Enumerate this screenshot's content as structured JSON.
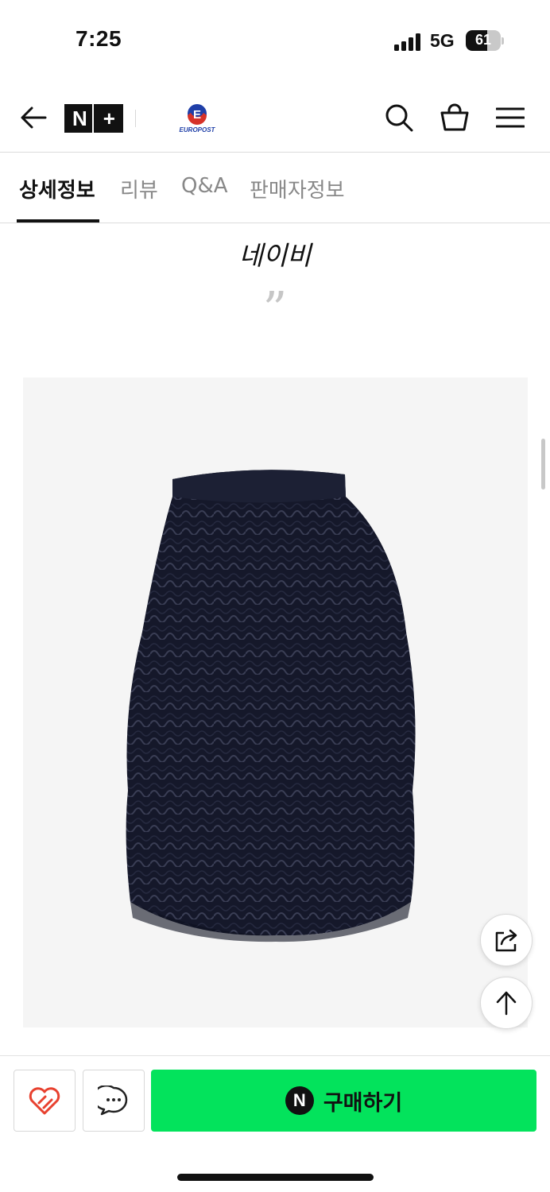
{
  "status_bar": {
    "time": "7:25",
    "network": "5G",
    "battery": "61",
    "battery_level": 0.61
  },
  "header": {
    "logo_text": "N+",
    "logo_n": "N",
    "logo_plus": "+",
    "store_logo_letter": "E",
    "store_logo_text": "EUROPOST",
    "icons": [
      "back-arrow-icon",
      "search-icon",
      "shopping-bag-icon",
      "hamburger-menu-icon"
    ]
  },
  "tabs": [
    {
      "label": "상세정보",
      "active": true
    },
    {
      "label": "리뷰",
      "active": false
    },
    {
      "label": "Q&A",
      "active": false
    },
    {
      "label": "판매자정보",
      "active": false
    }
  ],
  "content": {
    "color_caption": "네이비",
    "quote_mark": "”",
    "product_image_alt": "navy tiered tulle skirt"
  },
  "floating": {
    "icons": [
      "share-icon",
      "arrow-up-icon"
    ]
  },
  "bottom_bar": {
    "buy_label": "구매하기",
    "npay_letter": "N",
    "wish_icon": "heart-icon",
    "talk_icon": "chat-bubble-icon",
    "accent_color": "#03e35c",
    "wish_color": "#e8412f"
  }
}
